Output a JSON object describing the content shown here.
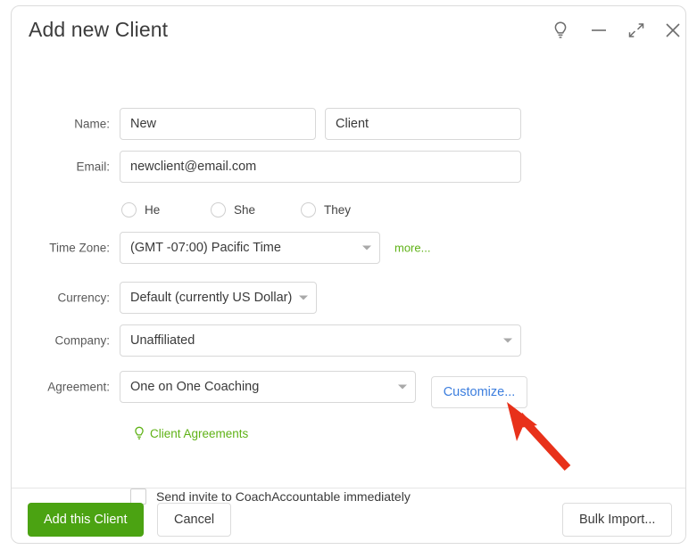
{
  "window": {
    "title": "Add new Client",
    "controls": [
      {
        "name": "hint-lightbulb-icon",
        "label": ""
      },
      {
        "name": "minimize-icon",
        "label": ""
      },
      {
        "name": "restore-icon",
        "label": ""
      },
      {
        "name": "close-icon",
        "label": ""
      }
    ]
  },
  "form": {
    "name": {
      "label": "Name:",
      "first_value": "New",
      "first_placeholder": "First",
      "last_value": "Client",
      "last_placeholder": "Last"
    },
    "email": {
      "label": "Email:",
      "value": "newclient@email.com",
      "placeholder": "Email"
    },
    "pronouns": {
      "options": [
        "He",
        "She",
        "They"
      ],
      "selected": ""
    },
    "timezone": {
      "label": "Time Zone:",
      "value": "(GMT -07:00) Pacific Time",
      "more_label": "more..."
    },
    "currency": {
      "label": "Currency:",
      "value": "Default (currently US Dollar)"
    },
    "company": {
      "label": "Company:",
      "value": "Unaffiliated"
    },
    "agreement": {
      "label": "Agreement:",
      "value": "One on One Coaching",
      "customize_label": "Customize...",
      "help_link_label": "Client Agreements"
    },
    "invite": {
      "label": "Send invite to CoachAccountable immediately",
      "checked": false
    }
  },
  "footer": {
    "primary_label": "Add this Client",
    "cancel_label": "Cancel",
    "bulk_import_label": "Bulk Import..."
  },
  "colors": {
    "primary_green": "#4ba312",
    "link_green": "#5fb216",
    "link_blue": "#3c7ede",
    "annotation_red": "#e8311a",
    "border": "#d8d8d8",
    "label_gray": "#595959"
  },
  "annotation": {
    "type": "arrow",
    "points_to": "customize-button",
    "color": "#e8311a"
  }
}
